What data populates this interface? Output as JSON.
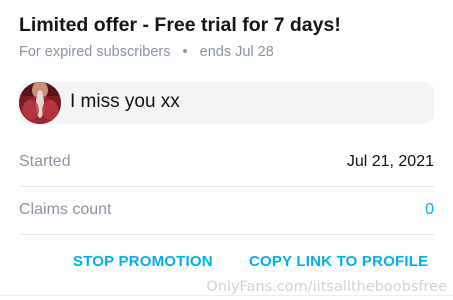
{
  "promo": {
    "title": "Limited offer - Free trial for 7 days!",
    "audience": "For expired subscribers",
    "separator": "•",
    "ends": "ends Jul 28"
  },
  "message": {
    "text": "I miss you xx",
    "avatar_icon": "user-avatar-photo"
  },
  "details": {
    "started_label": "Started",
    "started_value": "Jul 21, 2021",
    "claims_label": "Claims count",
    "claims_value": "0"
  },
  "actions": {
    "stop_label": "STOP PROMOTION",
    "copy_label": "COPY LINK TO PROFILE"
  },
  "watermark": "OnlyFans.com/iitsalltheboobsfree",
  "colors": {
    "accent": "#00aff0",
    "muted": "#8a96a3",
    "message_bg": "#f3f4f6"
  }
}
